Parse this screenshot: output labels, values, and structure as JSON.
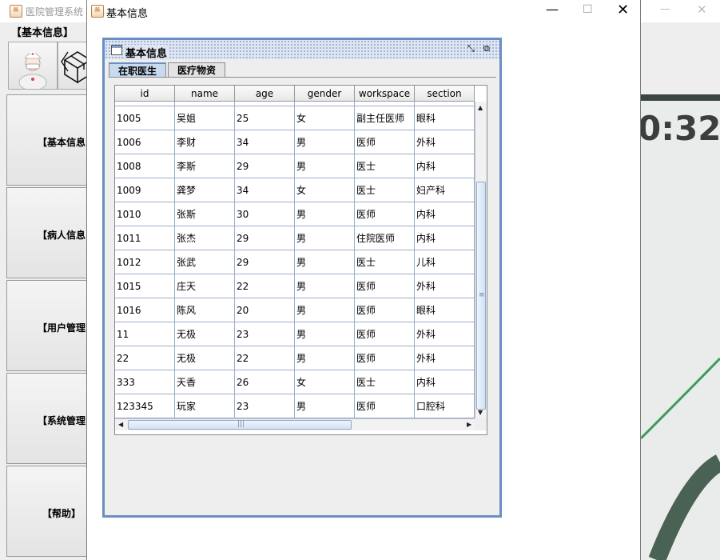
{
  "back_app": {
    "title": "医院管理系统",
    "menu_label": "【基本信息】",
    "side_buttons": [
      "【基本信息",
      "【病人信息",
      "【用户管理",
      "【系统管理",
      "【帮助】"
    ],
    "min_glyph": "—",
    "close_glyph": "✕",
    "clock": "0:32"
  },
  "dialog": {
    "title": "基本信息",
    "min_glyph": "—",
    "max_glyph": "☐",
    "close_glyph": "✕",
    "app_icon_glyph": "≝"
  },
  "internal_frame": {
    "title": "基本信息",
    "btn_a": "⤡",
    "btn_b": "⧉"
  },
  "tabs": [
    {
      "label": "在职医生",
      "selected": true
    },
    {
      "label": "医疗物资",
      "selected": false
    }
  ],
  "table": {
    "columns": [
      "id",
      "name",
      "age",
      "gender",
      "workspace",
      "section"
    ],
    "rows": [
      [
        "1005",
        "吴姐",
        "25",
        "女",
        "副主任医师",
        "眼科"
      ],
      [
        "1006",
        "李财",
        "34",
        "男",
        "医师",
        "外科"
      ],
      [
        "1008",
        "李斯",
        "29",
        "男",
        "医士",
        "内科"
      ],
      [
        "1009",
        "龚梦",
        "34",
        "女",
        "医士",
        "妇产科"
      ],
      [
        "1010",
        "张斯",
        "30",
        "男",
        "医师",
        "内科"
      ],
      [
        "1011",
        "张杰",
        "29",
        "男",
        "住院医师",
        "内科"
      ],
      [
        "1012",
        "张武",
        "29",
        "男",
        "医士",
        "儿科"
      ],
      [
        "1015",
        "庄天",
        "22",
        "男",
        "医师",
        "外科"
      ],
      [
        "1016",
        "陈风",
        "20",
        "男",
        "医师",
        "眼科"
      ],
      [
        "11",
        "无极",
        "23",
        "男",
        "医师",
        "外科"
      ],
      [
        "22",
        "无极",
        "22",
        "男",
        "医师",
        "外科"
      ],
      [
        "333",
        "天香",
        "26",
        "女",
        "医士",
        "内科"
      ],
      [
        "123345",
        "玩家",
        "23",
        "男",
        "医师",
        "口腔科"
      ]
    ]
  },
  "scroll": {
    "up": "▲",
    "down": "▼",
    "left": "◀",
    "right": "▶",
    "v_grip": "≡",
    "h_grip": "|||"
  }
}
